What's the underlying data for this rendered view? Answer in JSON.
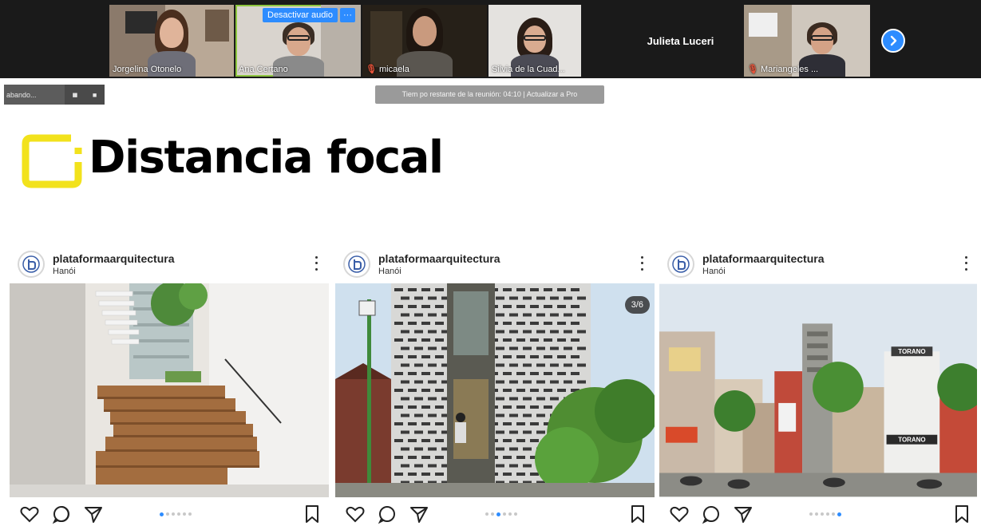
{
  "zoom": {
    "participants": [
      {
        "name": "Jorgelina Otonelo",
        "muted": false
      },
      {
        "name": "Ana Certano",
        "muted": false,
        "active_speaker": true
      },
      {
        "name": "micaela",
        "muted": true
      },
      {
        "name": "Silvia de la Cuad...",
        "muted": false
      },
      {
        "name": "Julieta Luceri",
        "video": false
      },
      {
        "name": "Mariangeles ...",
        "muted": true
      }
    ],
    "mute_overlay_label": "Desactivar audio",
    "more_overlay_label": "···",
    "recording_label": "abando...",
    "pause_icon_label": "▮▮",
    "stop_icon_label": "■",
    "timer_text": "Tiem po restante de la reunión: 04:10 | Actualizar a Pro",
    "accent_color": "#2d8cff"
  },
  "brand": {
    "title": "Distancia focal",
    "logo_color": "#f2e21c"
  },
  "posts": [
    {
      "account": "plataformaarquitectura",
      "location": "Hanói",
      "image": "interior-staircase",
      "active_dot": 0
    },
    {
      "account": "plataformaarquitectura",
      "location": "Hanói",
      "image": "brick-facade",
      "counter": "3/6",
      "active_dot": 2
    },
    {
      "account": "plataformaarquitectura",
      "location": "Hanói",
      "image": "street-view",
      "active_dot": 5
    }
  ],
  "street_signs": {
    "sign_top": "TORANO",
    "sign_bottom": "TORANO"
  },
  "icons": [
    "heart-icon",
    "comment-icon",
    "share-icon",
    "bookmark-icon",
    "more-icon",
    "chevron-right-icon"
  ]
}
